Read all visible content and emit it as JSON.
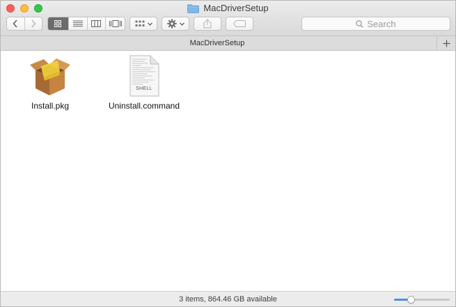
{
  "window": {
    "title": "MacDriverSetup"
  },
  "toolbar": {
    "back_icon": "chevron-left-icon",
    "forward_icon": "chevron-right-icon",
    "views": [
      {
        "name": "icon-view",
        "icon": "grid-icon",
        "active": true
      },
      {
        "name": "list-view",
        "icon": "list-icon",
        "active": false
      },
      {
        "name": "column-view",
        "icon": "columns-icon",
        "active": false
      },
      {
        "name": "coverflow-view",
        "icon": "coverflow-icon",
        "active": false
      }
    ],
    "search_placeholder": "Search"
  },
  "pathbar": {
    "title": "MacDriverSetup"
  },
  "items": [
    {
      "name": "Install.pkg",
      "kind": "package"
    },
    {
      "name": "Uninstall.command",
      "kind": "shell",
      "badge": "SHELL"
    }
  ],
  "status": {
    "text": "3 items, 864.46 GB available"
  },
  "zoom": {
    "level": 0.28
  },
  "colors": {
    "accent": "#4a90e2",
    "close": "#fc605b",
    "minimize": "#fdbc40",
    "maximize": "#34c84a",
    "folder": "#7fb8e8"
  }
}
